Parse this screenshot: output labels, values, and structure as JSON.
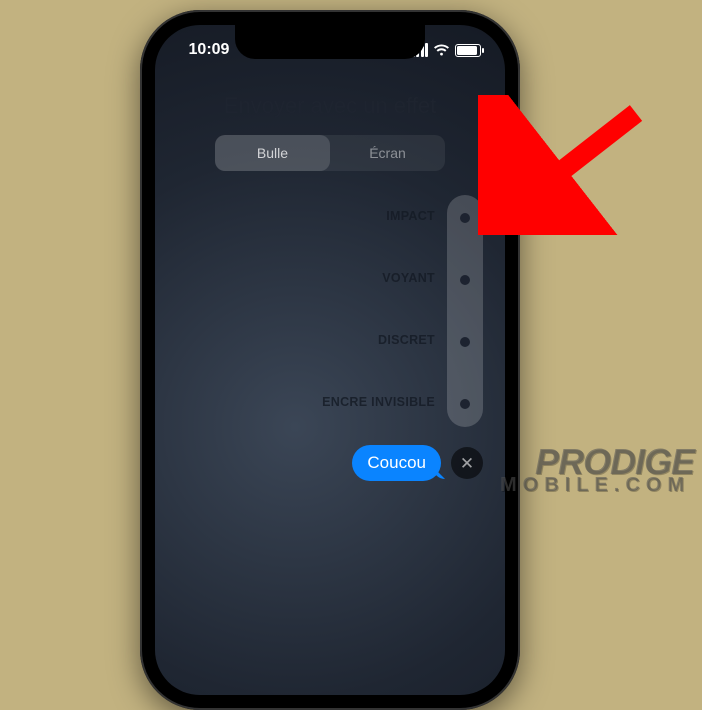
{
  "status": {
    "time": "10:09"
  },
  "title": "Envoyer avec un effet",
  "tabs": {
    "bubble": "Bulle",
    "screen": "Écran"
  },
  "effects": {
    "impact": "IMPACT",
    "loud": "VOYANT",
    "gentle": "DISCRET",
    "invisible": "ENCRE INVISIBLE"
  },
  "message": {
    "text": "Coucou"
  },
  "watermark": {
    "line1": "PRODIGE",
    "line2": "MOBILE.COM"
  }
}
